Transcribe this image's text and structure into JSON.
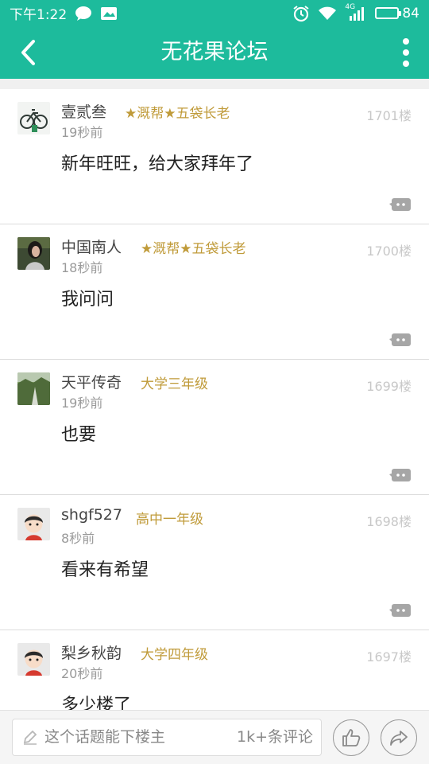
{
  "status_bar": {
    "time": "下午1:22",
    "network_label": "4G",
    "battery": "84",
    "battery_fraction": 0.84,
    "icons": [
      "chat-bubble-icon",
      "image-notification-icon",
      "alarm-clock-icon",
      "wifi-icon",
      "signal-icon",
      "battery-icon"
    ]
  },
  "header": {
    "title": "无花果论坛",
    "back_icon": "chevron-left-icon",
    "more_icon": "more-vertical-icon"
  },
  "colors": {
    "accent": "#1dbb9c",
    "rank": "#c09b3a",
    "text": "#222222",
    "muted": "#9a9a9a"
  },
  "posts": [
    {
      "username": "壹贰叁",
      "rank": "★溉帮★五袋长老",
      "time": "19秒前",
      "floor": "1701楼",
      "content": "新年旺旺，给大家拜年了",
      "avatar": "bicycle-photo"
    },
    {
      "username": "中国南人",
      "rank": "★溉帮★五袋长老",
      "time": "18秒前",
      "floor": "1700楼",
      "content": "我问问",
      "avatar": "woman-photo"
    },
    {
      "username": "天平传奇",
      "rank": "大学三年级",
      "time": "19秒前",
      "floor": "1699楼",
      "content": "也要",
      "avatar": "landscape-photo"
    },
    {
      "username": "shgf527",
      "rank": "高中一年级",
      "time": "8秒前",
      "floor": "1698楼",
      "content": "看来有希望",
      "avatar": "default-boy-avatar"
    },
    {
      "username": "梨乡秋韵",
      "rank": "大学四年级",
      "time": "20秒前",
      "floor": "1697楼",
      "content": "多少楼了",
      "avatar": "default-boy-avatar"
    }
  ],
  "bottom_bar": {
    "comment_placeholder": "这个话题能下楼主",
    "comment_count": "1k+条评论",
    "like_icon": "thumbs-up-icon",
    "share_icon": "share-arrow-icon"
  }
}
